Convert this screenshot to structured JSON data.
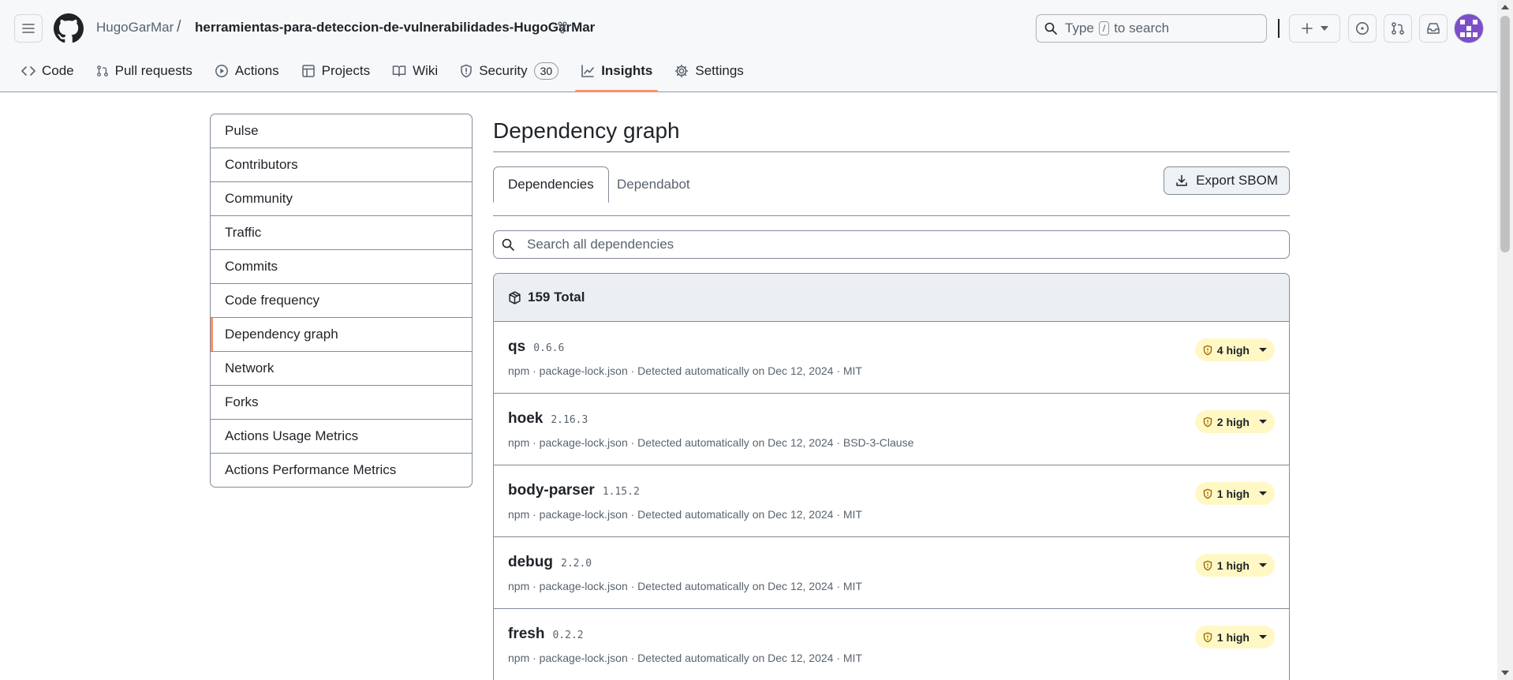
{
  "header": {
    "owner": "HugoGarMar",
    "separator": "/",
    "repo": "herramientas-para-deteccion-de-vulnerabilidades-HugoGarMar",
    "search_prefix": "Type",
    "search_key": "/",
    "search_suffix": "to search"
  },
  "nav": [
    {
      "label": "Code",
      "icon": "code-icon"
    },
    {
      "label": "Pull requests",
      "icon": "pull-request-icon"
    },
    {
      "label": "Actions",
      "icon": "play-icon"
    },
    {
      "label": "Projects",
      "icon": "table-icon"
    },
    {
      "label": "Wiki",
      "icon": "book-icon"
    },
    {
      "label": "Security",
      "icon": "shield-icon",
      "counter": "30"
    },
    {
      "label": "Insights",
      "icon": "graph-icon",
      "active": true
    },
    {
      "label": "Settings",
      "icon": "gear-icon"
    }
  ],
  "sidebar": {
    "items": [
      {
        "label": "Pulse"
      },
      {
        "label": "Contributors"
      },
      {
        "label": "Community"
      },
      {
        "label": "Traffic"
      },
      {
        "label": "Commits"
      },
      {
        "label": "Code frequency"
      },
      {
        "label": "Dependency graph",
        "selected": true
      },
      {
        "label": "Network"
      },
      {
        "label": "Forks"
      },
      {
        "label": "Actions Usage Metrics"
      },
      {
        "label": "Actions Performance Metrics"
      }
    ]
  },
  "main": {
    "title": "Dependency graph",
    "tabs": [
      {
        "label": "Dependencies",
        "active": true
      },
      {
        "label": "Dependabot"
      }
    ],
    "export_label": "Export SBOM",
    "search_placeholder": "Search all dependencies",
    "total_label": "159 Total",
    "dependencies": [
      {
        "name": "qs",
        "version": "0.6.6",
        "meta": "npm · package-lock.json · Detected automatically on Dec 12, 2024 · MIT",
        "severity": "4 high"
      },
      {
        "name": "hoek",
        "version": "2.16.3",
        "meta": "npm · package-lock.json · Detected automatically on Dec 12, 2024 · BSD-3-Clause",
        "severity": "2 high"
      },
      {
        "name": "body-parser",
        "version": "1.15.2",
        "meta": "npm · package-lock.json · Detected automatically on Dec 12, 2024 · MIT",
        "severity": "1 high"
      },
      {
        "name": "debug",
        "version": "2.2.0",
        "meta": "npm · package-lock.json · Detected automatically on Dec 12, 2024 · MIT",
        "severity": "1 high"
      },
      {
        "name": "fresh",
        "version": "0.2.2",
        "meta": "npm · package-lock.json · Detected automatically on Dec 12, 2024 · MIT",
        "severity": "1 high"
      }
    ]
  },
  "colors": {
    "accent_underline": "#fd8c73",
    "severity_bg": "#fff8c5",
    "avatar": "#7b4fc9"
  }
}
